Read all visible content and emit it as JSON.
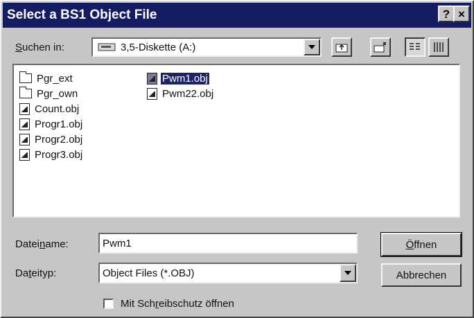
{
  "window": {
    "title": "Select a BS1 Object File",
    "help_label": "?",
    "close_label": "×"
  },
  "look_in": {
    "label_pre": "",
    "label_u": "S",
    "label_post": "uchen in:",
    "value": "3,5-Diskette (A:)",
    "drive_icon": "floppy-drive-icon"
  },
  "toolbar": {
    "up_icon": "up-one-level-icon",
    "new_folder_icon": "new-folder-icon",
    "list_icon": "list-view-icon",
    "details_icon": "details-view-icon"
  },
  "files": {
    "column1": [
      {
        "name": "Pgr_ext",
        "type": "folder"
      },
      {
        "name": "Pgr_own",
        "type": "folder"
      },
      {
        "name": "Count.obj",
        "type": "file"
      },
      {
        "name": "Progr1.obj",
        "type": "file"
      },
      {
        "name": "Progr2.obj",
        "type": "file"
      },
      {
        "name": "Progr3.obj",
        "type": "file"
      }
    ],
    "column2": [
      {
        "name": "Pwm1.obj",
        "type": "file",
        "selected": true
      },
      {
        "name": "Pwm22.obj",
        "type": "file"
      }
    ]
  },
  "filename": {
    "label_pre": "Datei",
    "label_u": "n",
    "label_post": "ame:",
    "value": "Pwm1"
  },
  "filetype": {
    "label_pre": "Da",
    "label_u": "t",
    "label_post": "eityp:",
    "value": "Object Files (*.OBJ)"
  },
  "buttons": {
    "open_pre": "",
    "open_u": "Ö",
    "open_post": "ffnen",
    "cancel": "Abbrechen"
  },
  "readonly": {
    "label_pre": "Mit Sch",
    "label_u": "r",
    "label_post": "eibschutz öffnen",
    "checked": false
  }
}
